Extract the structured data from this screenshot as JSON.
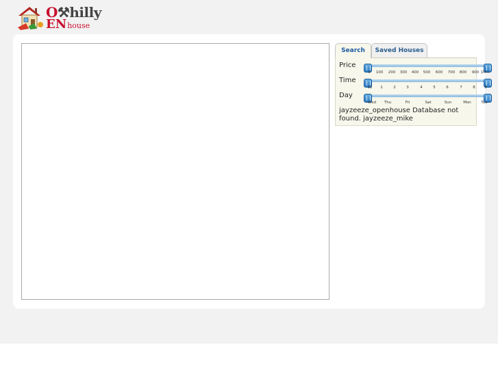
{
  "logo": {
    "line1_a": "O",
    "line1_b": "hilly",
    "line2_a": "EN",
    "line2_b": "house",
    "icon": "house-icon"
  },
  "tabs": [
    {
      "label": "Search",
      "active": true
    },
    {
      "label": "Saved Houses",
      "active": false
    }
  ],
  "sliders": {
    "price": {
      "label": "Price",
      "ticks": [
        "0",
        "100",
        "200",
        "300",
        "400",
        "500",
        "600",
        "700",
        "800",
        "900",
        "1M+"
      ],
      "range": [
        "0",
        "1M+"
      ]
    },
    "time": {
      "label": "Time",
      "ticks": [
        "12",
        "1",
        "2",
        "3",
        "4",
        "5",
        "6",
        "7",
        "8",
        "9"
      ],
      "range": [
        "12",
        "9"
      ]
    },
    "day": {
      "label": "Day",
      "ticks": [
        "Wed",
        "Thu",
        "Fri",
        "Sat",
        "Sun",
        "Mon",
        "Tue"
      ],
      "range": [
        "Wed",
        "Tue"
      ]
    }
  },
  "status_message": "jayzeeze_openhouse Database not found. jayzeeze_mike",
  "colors": {
    "brand_red": "#c8102e",
    "tab_text": "#1b5aa0",
    "slider_handle": "#2e7bc2",
    "panel_bg": "#f8f7ec"
  }
}
